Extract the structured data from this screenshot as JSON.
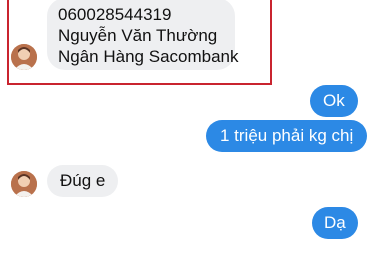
{
  "conversation": {
    "messages": [
      {
        "sender": "contact",
        "lines": [
          "060028544319",
          "Nguyễn Văn Thường",
          "Ngân Hàng Sacombank"
        ]
      },
      {
        "sender": "me",
        "text": "Ok"
      },
      {
        "sender": "me",
        "text": "1 triệu phải kg chị"
      },
      {
        "sender": "contact",
        "text": "Đúg e"
      },
      {
        "sender": "me",
        "text": "Dạ"
      }
    ]
  },
  "colors": {
    "outgoing_bubble": "#2c89e5",
    "incoming_bubble": "#eeeff1",
    "highlight_border": "#c9242f"
  },
  "icons": {
    "avatar": "contact-avatar-icon"
  }
}
